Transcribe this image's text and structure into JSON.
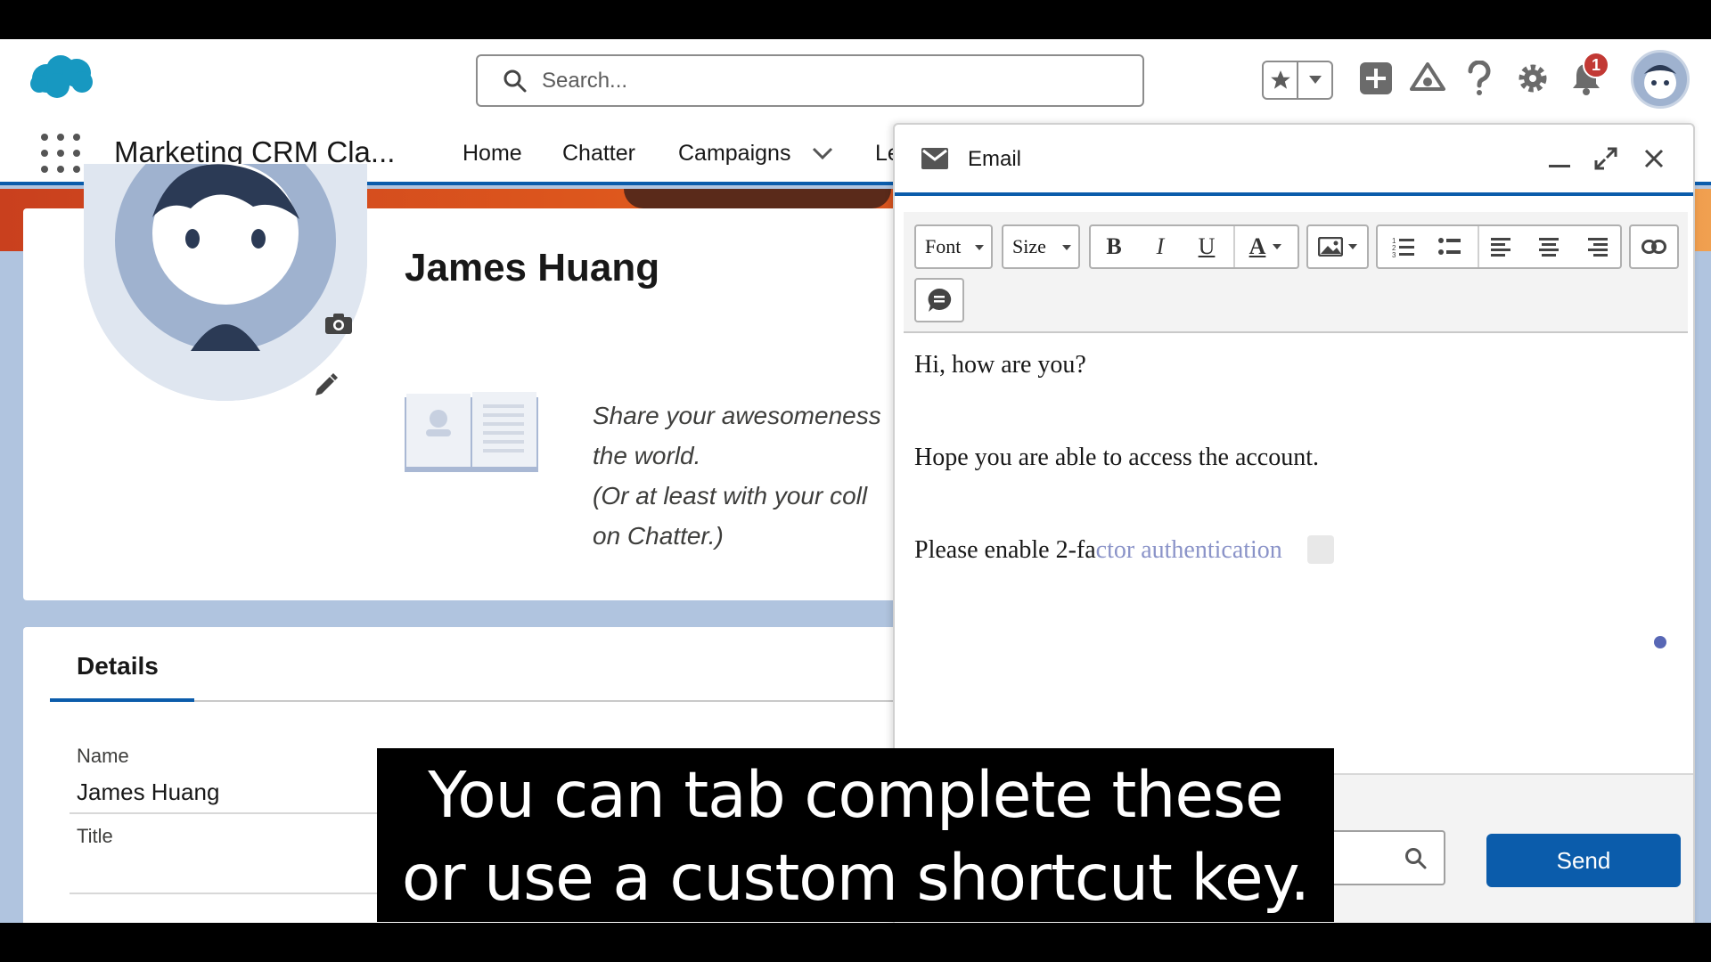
{
  "global_header": {
    "search_placeholder": "Search...",
    "notification_count": "1",
    "icons": [
      "salesforce-cloud-logo",
      "search-icon",
      "star-icon",
      "chevron-down-icon",
      "add-icon",
      "trailhead-icon",
      "help-icon",
      "gear-icon",
      "bell-icon",
      "avatar"
    ]
  },
  "navbar": {
    "app_name": "Marketing CRM Cla...",
    "items": [
      {
        "label": "Home"
      },
      {
        "label": "Chatter"
      },
      {
        "label": "Campaigns"
      },
      {
        "label": "Le"
      }
    ]
  },
  "profile": {
    "name": "James Huang",
    "share_lines": [
      "Share your awesomeness",
      "the world.",
      "(Or at least with your coll",
      "on Chatter.)"
    ]
  },
  "details": {
    "tab": "Details",
    "fields": [
      {
        "label": "Name",
        "value": "James Huang"
      },
      {
        "label": "Title",
        "value": ""
      }
    ]
  },
  "email": {
    "title": "Email",
    "toolbar": {
      "font_label": "Font",
      "size_label": "Size",
      "bold": "B",
      "italic": "I",
      "underline": "U",
      "text_color": "A"
    },
    "body": {
      "line1": "Hi, how are you?",
      "line2": "Hope you are able to access the account.",
      "line3_typed": "Please enable 2-fa",
      "line3_suggestion": "ctor authentication"
    },
    "send_label": "Send"
  },
  "caption": {
    "line1": "You can tab complete these",
    "line2": "or use a custom shortcut key."
  },
  "colors": {
    "brand_blue": "#0b5cab",
    "banner_orange": "#e05a1d",
    "notification_red": "#c23934",
    "suggestion_text": "#8a93c8"
  }
}
